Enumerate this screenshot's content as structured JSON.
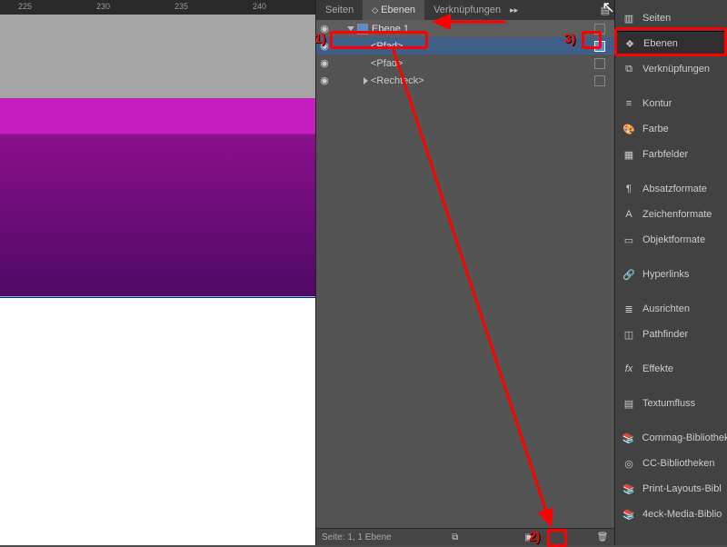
{
  "ruler": {
    "ticks": [
      "225",
      "230",
      "235",
      "240"
    ]
  },
  "tabs": {
    "seiten": "Seiten",
    "ebenen": "Ebenen",
    "verk": "Verknüpfungen"
  },
  "layers": {
    "layer1": "Ebene 1",
    "item1": "<Pfad>",
    "item2": "<Pfad>",
    "item3": "<Rechteck>"
  },
  "status": {
    "text": "Seite: 1, 1 Ebene"
  },
  "dock": {
    "seiten": "Seiten",
    "ebenen": "Ebenen",
    "verk": "Verknüpfungen",
    "kontur": "Kontur",
    "farbe": "Farbe",
    "farbfelder": "Farbfelder",
    "absatz": "Absatzformate",
    "zeichen": "Zeichenformate",
    "objekt": "Objektformate",
    "hyper": "Hyperlinks",
    "ausrichten": "Ausrichten",
    "pathfinder": "Pathfinder",
    "effekte": "Effekte",
    "textumfluss": "Textumfluss",
    "commag": "Commag-Bibliothek",
    "cc": "CC-Bibliotheken",
    "print": "Print-Layouts-Bibl",
    "eck": "4eck-Media-Biblio"
  },
  "anno": {
    "n1": "1)",
    "n2": "2)",
    "n3": "3)"
  }
}
